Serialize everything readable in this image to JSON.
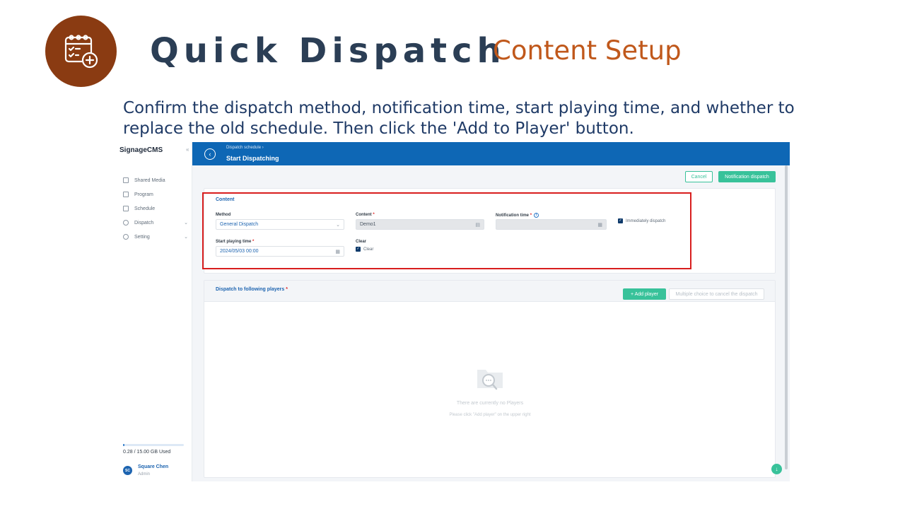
{
  "slide": {
    "title": "Quick Dispatch",
    "subtitle": "Content Setup",
    "instruction": "Confirm the dispatch method, notification time, start playing time, and whether to replace the old schedule. Then click the 'Add to Player' button."
  },
  "sidebar": {
    "brand": "SignageCMS",
    "collapse": "«",
    "items": [
      {
        "label": "Shared Media"
      },
      {
        "label": "Program"
      },
      {
        "label": "Schedule"
      },
      {
        "label": "Dispatch",
        "chevron": "⌄"
      },
      {
        "label": "Setting",
        "chevron": "⌄"
      }
    ],
    "storage": {
      "text": "0.28 / 15.00 GB Used",
      "used_fraction": 0.0187
    },
    "user": {
      "initials": "SC",
      "name": "Square Chen",
      "role": "Admin"
    }
  },
  "header": {
    "back": "‹",
    "breadcrumb": "Dispatch schedule  ›",
    "title": "Start Dispatching"
  },
  "actions": {
    "cancel": "Cancel",
    "notify": "Notification dispatch"
  },
  "content": {
    "title": "Content",
    "method": {
      "label": "Method",
      "value": "General Dispatch",
      "caret": "⌄"
    },
    "content_field": {
      "label": "Content",
      "required": "*",
      "value": "Demo1"
    },
    "notification": {
      "label": "Notification time",
      "required": "*",
      "info": "i",
      "value": ""
    },
    "immediately": {
      "label": "Immediately dispatch",
      "checked": true
    },
    "start": {
      "label": "Start playing time",
      "required": "*",
      "value": "2024/05/03 00:00"
    },
    "clear": {
      "label": "Clear",
      "checkbox_label": "Clear",
      "checked": true
    }
  },
  "players": {
    "title": "Dispatch to following players",
    "required": "*",
    "add": "+ Add player",
    "multi": "Multiple choice to cancel the dispatch",
    "empty_title": "There are currently no Players",
    "empty_hint": "Please click \"Add player\" on the upper right"
  },
  "colors": {
    "brand_blue": "#0e67b5",
    "accent_green": "#38c29a",
    "highlight_red": "#d81e1e",
    "logo_brown": "#8a3b12"
  }
}
